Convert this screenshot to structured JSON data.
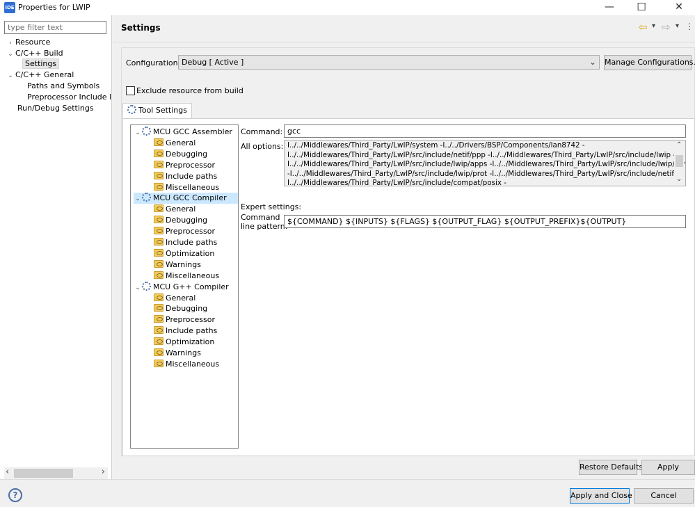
{
  "window": {
    "app_icon": "IDE",
    "title": "Properties for LWIP",
    "minimize": "—",
    "maximize": "☐",
    "close": "✕"
  },
  "sidebar": {
    "filter_placeholder": "type filter text",
    "items": [
      {
        "label": "Resource",
        "arrow": "›"
      },
      {
        "label": "C/C++ Build",
        "arrow": "⌄"
      },
      {
        "label": "Settings"
      },
      {
        "label": "C/C++ General",
        "arrow": "⌄"
      },
      {
        "label": "Paths and Symbols"
      },
      {
        "label": "Preprocessor Include Pat"
      },
      {
        "label": "Run/Debug Settings"
      }
    ],
    "scroll_left": "‹",
    "scroll_right": "›"
  },
  "header": {
    "title": "Settings",
    "back_icon": "⇦",
    "forward_icon": "⇨",
    "dropdown": "▾",
    "menu": "⋮"
  },
  "config": {
    "label": "Configuration:",
    "value": "Debug  [ Active ]",
    "dropdown_arrow": "⌄",
    "manage_button": "Manage Configurations..."
  },
  "exclude_label": "Exclude resource from build",
  "tab_label": "Tool Settings",
  "tool_tree": [
    {
      "label": "MCU GCC Assembler",
      "type": "tool",
      "selected": false
    },
    {
      "label": "General",
      "type": "cat"
    },
    {
      "label": "Debugging",
      "type": "cat"
    },
    {
      "label": "Preprocessor",
      "type": "cat"
    },
    {
      "label": "Include paths",
      "type": "cat"
    },
    {
      "label": "Miscellaneous",
      "type": "cat"
    },
    {
      "label": "MCU GCC Compiler",
      "type": "tool",
      "selected": true
    },
    {
      "label": "General",
      "type": "cat"
    },
    {
      "label": "Debugging",
      "type": "cat"
    },
    {
      "label": "Preprocessor",
      "type": "cat"
    },
    {
      "label": "Include paths",
      "type": "cat"
    },
    {
      "label": "Optimization",
      "type": "cat"
    },
    {
      "label": "Warnings",
      "type": "cat"
    },
    {
      "label": "Miscellaneous",
      "type": "cat"
    },
    {
      "label": "MCU G++ Compiler",
      "type": "tool",
      "selected": false
    },
    {
      "label": "General",
      "type": "cat"
    },
    {
      "label": "Debugging",
      "type": "cat"
    },
    {
      "label": "Preprocessor",
      "type": "cat"
    },
    {
      "label": "Include paths",
      "type": "cat"
    },
    {
      "label": "Optimization",
      "type": "cat"
    },
    {
      "label": "Warnings",
      "type": "cat"
    },
    {
      "label": "Miscellaneous",
      "type": "cat"
    }
  ],
  "details": {
    "command_label": "Command:",
    "command_value": "gcc",
    "all_options_label": "All options:",
    "all_options_lines": [
      "I../../Middlewares/Third_Party/LwIP/system -I../../Drivers/BSP/Components/lan8742 -",
      "I../../Middlewares/Third_Party/LwIP/src/include/netif/ppp -I../../Middlewares/Third_Party/LwIP/src/include/lwip -",
      "I../../Middlewares/Third_Party/LwIP/src/include/lwip/apps -I../../Middlewares/Third_Party/LwIP/src/include/lwip/priv",
      "-I../../Middlewares/Third_Party/LwIP/src/include/lwip/prot -I../../Middlewares/Third_Party/LwIP/src/include/netif -",
      "I../../Middlewares/Third_Party/LwIP/src/include/compat/posix -"
    ],
    "scroll_up": "⌃",
    "scroll_down": "⌄",
    "expert_label": "Expert settings:",
    "pattern_label_1": "Command",
    "pattern_label_2": "line pattern:",
    "pattern_value": "${COMMAND} ${INPUTS} ${FLAGS} ${OUTPUT_FLAG} ${OUTPUT_PREFIX}${OUTPUT}"
  },
  "buttons": {
    "restore": "Restore Defaults",
    "apply": "Apply",
    "apply_close": "Apply and Close",
    "cancel": "Cancel",
    "help": "?"
  }
}
